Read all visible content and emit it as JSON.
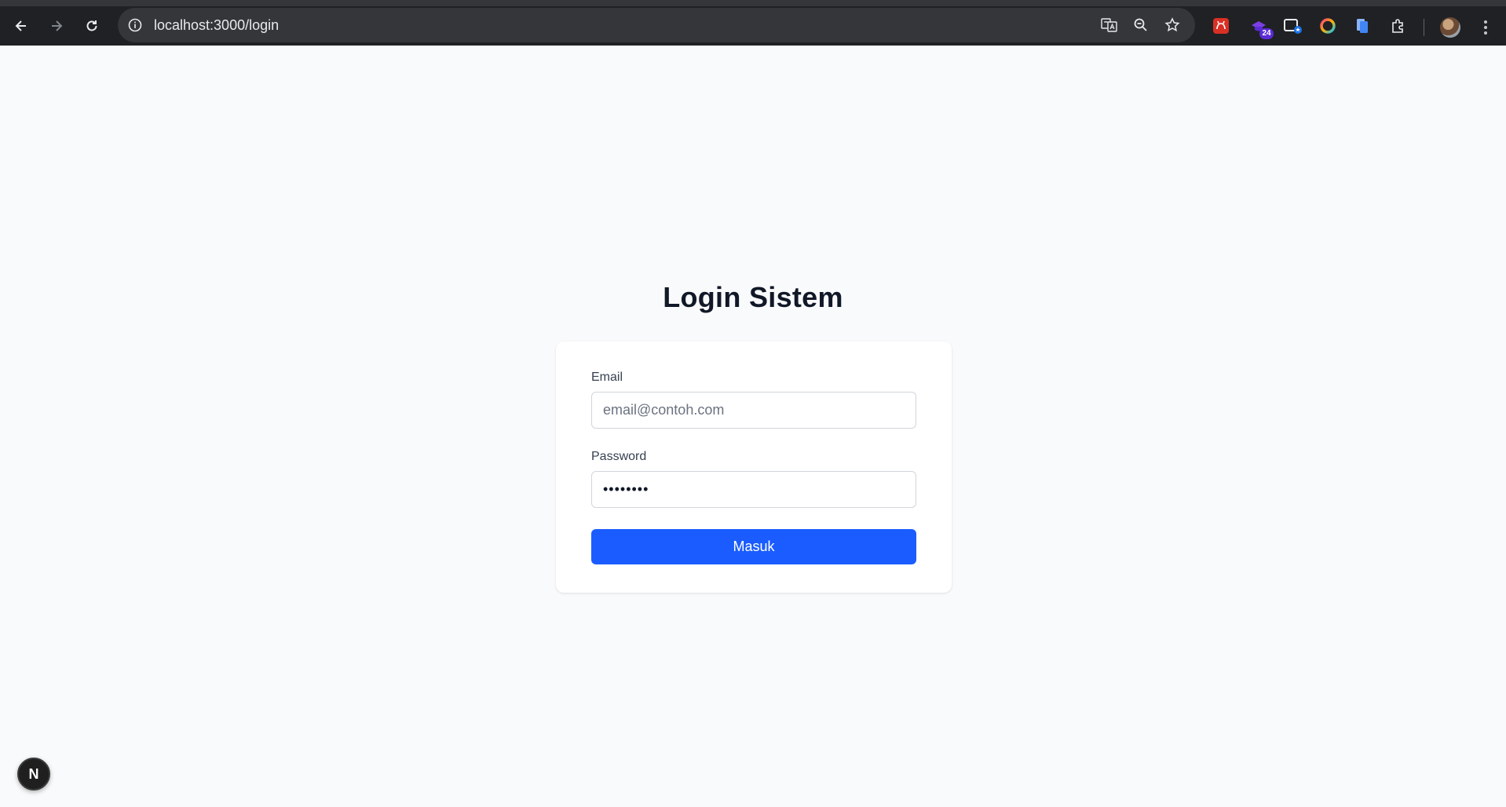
{
  "browser": {
    "url": "localhost:3000/login",
    "extensions": {
      "badge_count": "24"
    }
  },
  "page": {
    "title": "Login Sistem"
  },
  "form": {
    "email_label": "Email",
    "email_placeholder": "email@contoh.com",
    "email_value": "",
    "password_label": "Password",
    "password_value": "••••••••",
    "submit_label": "Masuk"
  },
  "dev_indicator": {
    "letter": "N"
  },
  "colors": {
    "primary": "#1a5cff",
    "title": "#111827",
    "background": "#f9fafb"
  }
}
